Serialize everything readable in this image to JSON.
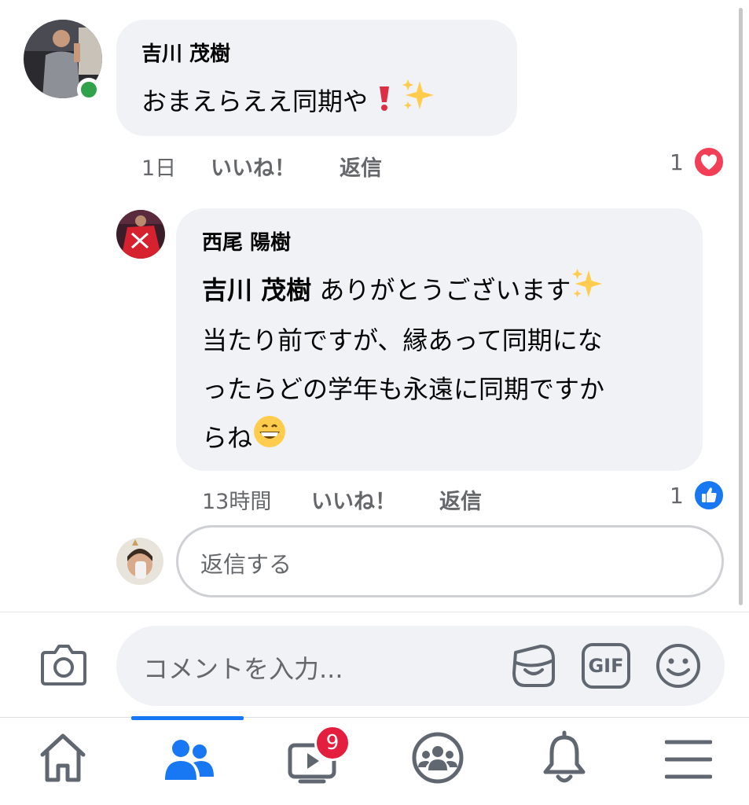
{
  "comments": [
    {
      "author": "吉川 茂樹",
      "text": "おまえらええ同期や",
      "emojis": [
        "exclamation-emoji",
        "sparkles-emoji"
      ],
      "online": true,
      "time": "1日",
      "like_label": "いいね！",
      "reply_label": "返信",
      "reaction_count": "1",
      "reaction": "love-reaction-icon",
      "reaction_color": "#f33e58"
    },
    {
      "author": "西尾 陽樹",
      "mention": "吉川 茂樹",
      "line1": " ありがとうございます",
      "line2": "当たり前ですが、縁あって同期にな",
      "line3": "ったらどの学年も永遠に同期ですか",
      "line4": "らね",
      "emojis": [
        "sparkles-emoji",
        "grinning-face-emoji"
      ],
      "time": "13時間",
      "like_label": "いいね！",
      "reply_label": "返信",
      "reaction_count": "1",
      "reaction": "like-reaction-icon",
      "reaction_color": "#1877f2"
    }
  ],
  "reply_box": {
    "placeholder": "返信する"
  },
  "composer": {
    "placeholder": "コメントを入力...",
    "icons": [
      "camera-icon",
      "sticker-icon",
      "gif-icon",
      "emoji-icon"
    ],
    "gif_label": "GIF"
  },
  "tabbar": {
    "tabs": [
      "home-icon",
      "friends-icon",
      "watch-icon",
      "groups-icon",
      "notifications-icon",
      "menu-icon"
    ],
    "active_tab": "friends-icon",
    "active_color": "#1877f2",
    "watch_badge": "9"
  }
}
